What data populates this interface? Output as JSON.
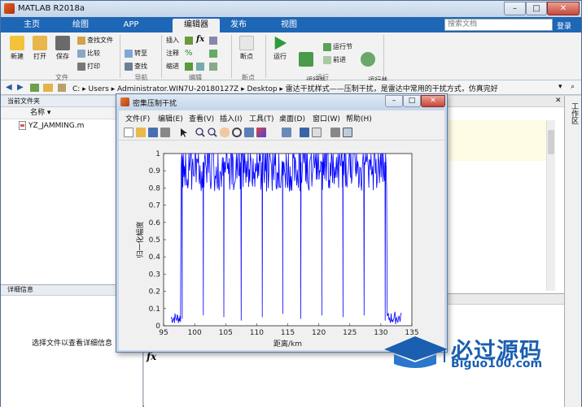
{
  "window": {
    "title": "MATLAB R2018a"
  },
  "tabs": [
    "主页",
    "绘图",
    "APP",
    "编辑器",
    "发布",
    "视图"
  ],
  "active_tab": "编辑器",
  "search": {
    "placeholder": "搜索文档"
  },
  "login": "登录",
  "ribbon": {
    "file": {
      "new": "新建",
      "open": "打开",
      "save": "保存",
      "find_files": "查找文件",
      "compare": "比较",
      "print": "打印",
      "group": "文件"
    },
    "nav": {
      "goto": "转至",
      "find": "查找",
      "group": "导航"
    },
    "edit": {
      "insert": "插入",
      "comment": "注释",
      "indent": "缩进",
      "group": "编辑"
    },
    "breakpoints": {
      "label": "断点",
      "group": "断点"
    },
    "run": {
      "run": "运行",
      "run_advance": "运行并\n前进",
      "run_section": "运行节",
      "advance": "前进",
      "run_time": "运行并\n计时",
      "group": "运行"
    }
  },
  "address": {
    "path": "C: ▸ Users ▸ Administrator.WIN7U-20180127Z ▸ Desktop ▸ 雷达干扰样式——压制干扰，是雷达中常用的干扰方式，仿真完好"
  },
  "current_folder": {
    "title": "当前文件夹",
    "col_name": "名称 ▾",
    "file": "YZ_JAMMING.m"
  },
  "details": {
    "title": "详细信息",
    "message": "选择文件以查看详细信息"
  },
  "editor": {
    "title": "雷达干扰样式——压制干扰，是雷达中常用的干扰方式，仿..."
  },
  "workspace": {
    "label": "工作区"
  },
  "command": {
    "prompt": "fx"
  },
  "figure": {
    "title": "密集压制干扰",
    "menu": [
      "文件(F)",
      "编辑(E)",
      "查看(V)",
      "插入(I)",
      "工具(T)",
      "桌面(D)",
      "窗口(W)",
      "帮助(H)"
    ]
  },
  "watermark": {
    "brand": "必过源码",
    "url": "Biguo100.com"
  },
  "colors": {
    "accent": "#1e66b6",
    "plot": "#0000ff"
  },
  "chart_data": {
    "type": "line",
    "xlabel": "距离/km",
    "ylabel": "归一化幅度",
    "xlim": [
      95,
      135
    ],
    "ylim": [
      0,
      1
    ],
    "xticks": [
      95,
      100,
      105,
      110,
      115,
      120,
      125,
      130,
      135
    ],
    "yticks": [
      0,
      0.1,
      0.2,
      0.3,
      0.4,
      0.5,
      0.6,
      0.7,
      0.8,
      0.9,
      1
    ],
    "grid": false,
    "series": [
      {
        "color": "#0000ff",
        "x_range": [
          96.2,
          133.3
        ],
        "noise_floor": [
          0.01,
          0.08
        ],
        "jam_region": [
          97.8,
          131.0
        ],
        "dense_peak_range": [
          0.78,
          1.0
        ],
        "dips": [
          {
            "x": 98.0,
            "y": 0.04
          },
          {
            "x": 101.4,
            "y": 0.06
          },
          {
            "x": 104.7,
            "y": 0.05
          },
          {
            "x": 107.5,
            "y": 0.03
          },
          {
            "x": 110.9,
            "y": 0.05
          },
          {
            "x": 114.2,
            "y": 0.07
          },
          {
            "x": 117.1,
            "y": 0.04
          },
          {
            "x": 120.5,
            "y": 0.06
          },
          {
            "x": 123.9,
            "y": 0.05
          },
          {
            "x": 127.3,
            "y": 0.06
          },
          {
            "x": 130.7,
            "y": 0.03
          }
        ]
      }
    ]
  }
}
